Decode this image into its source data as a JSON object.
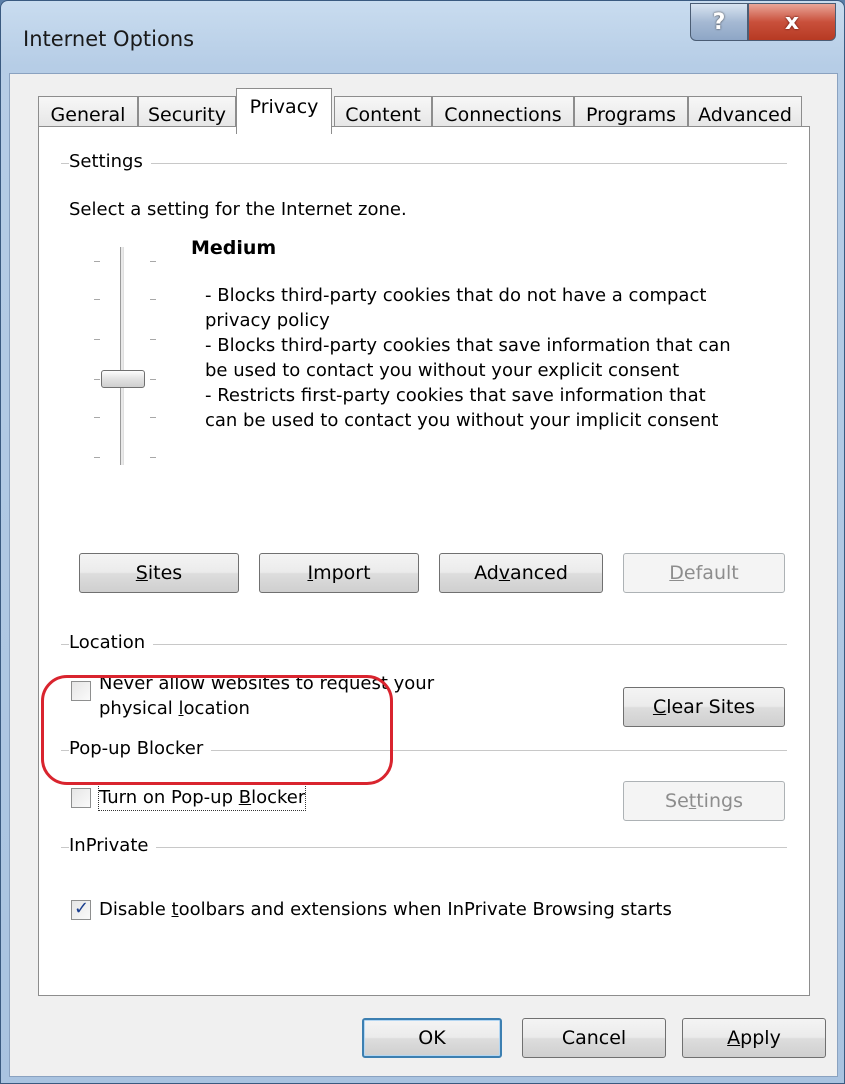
{
  "window": {
    "title": "Internet Options",
    "help_glyph": "?",
    "close_glyph": "x"
  },
  "tabs": [
    {
      "label": "General"
    },
    {
      "label": "Security"
    },
    {
      "label": "Privacy",
      "active": true
    },
    {
      "label": "Content"
    },
    {
      "label": "Connections"
    },
    {
      "label": "Programs"
    },
    {
      "label": "Advanced"
    }
  ],
  "settings": {
    "section_label": "Settings",
    "zone_text": "Select a setting for the Internet zone.",
    "level_name": "Medium",
    "description": [
      "- Blocks third-party cookies that do not have a compact",
      "privacy policy",
      "- Blocks third-party cookies that save information that can",
      "be used to contact you without your explicit consent",
      "- Restricts first-party cookies that save information that",
      "can be used to contact you without your implicit consent"
    ],
    "buttons": {
      "sites": {
        "pre": "",
        "key": "S",
        "post": "ites"
      },
      "import": {
        "pre": "",
        "key": "I",
        "post": "mport"
      },
      "advanced": {
        "pre": "Ad",
        "key": "v",
        "post": "anced"
      },
      "default": {
        "pre": "",
        "key": "D",
        "post": "efault"
      }
    }
  },
  "location": {
    "section_label": "Location",
    "checkbox_line1": "Never allow websites to request your",
    "checkbox_line2_pre": "physical ",
    "checkbox_line2_key": "l",
    "checkbox_line2_post": "ocation",
    "checked": false,
    "clear_sites": {
      "pre": "",
      "key": "C",
      "post": "lear Sites"
    }
  },
  "popup": {
    "section_label": "Pop-up Blocker",
    "checkbox_pre": "Turn on Pop-up ",
    "checkbox_key": "B",
    "checkbox_post": "locker",
    "checked": false,
    "settings_btn": {
      "pre": "Se",
      "key": "t",
      "post": "tings"
    }
  },
  "inprivate": {
    "section_label": "InPrivate",
    "checkbox_pre": "Disable ",
    "checkbox_key": "t",
    "checkbox_post": "oolbars and extensions when InPrivate Browsing starts",
    "checked": true
  },
  "footer": {
    "ok": "OK",
    "cancel": "Cancel",
    "apply": {
      "pre": "",
      "key": "A",
      "post": "pply"
    }
  },
  "colors": {
    "highlight_ring": "#d9242e",
    "default_button_border": "#3c7fb1"
  },
  "slider": {
    "level_index": 3,
    "levels": 6
  }
}
